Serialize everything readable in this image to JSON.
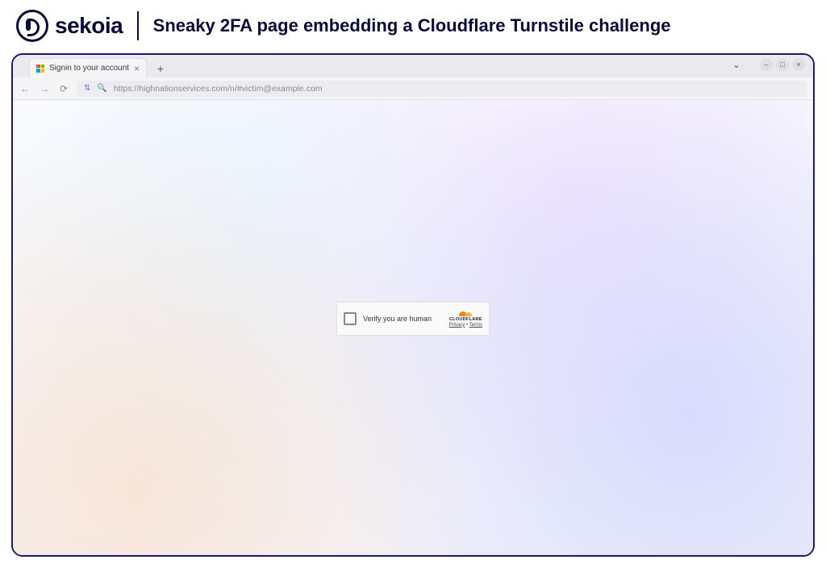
{
  "brand": {
    "name": "sekoia"
  },
  "header": {
    "title": "Sneaky 2FA page embedding a Cloudflare Turnstile challenge"
  },
  "browser": {
    "tab_title": "Signin to your account",
    "url": "https://highnationservices.com/n/#victim@example.com"
  },
  "turnstile": {
    "label": "Verify you are human",
    "brand": "CLOUDFLARE",
    "privacy": "Privacy",
    "terms": "Terms",
    "sep": " • "
  }
}
